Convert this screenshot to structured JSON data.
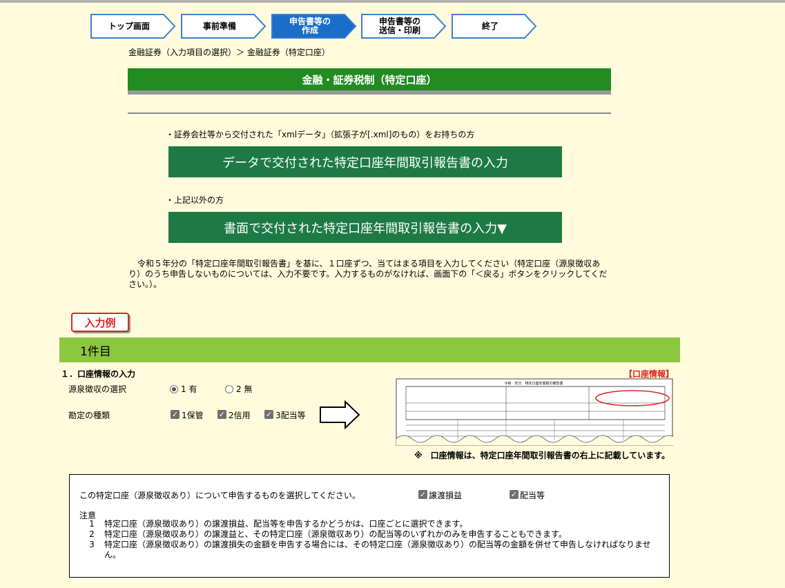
{
  "steps": [
    {
      "label": "トップ画面",
      "active": false
    },
    {
      "label": "事前準備",
      "active": false
    },
    {
      "label": "申告書等の\n作成",
      "active": true
    },
    {
      "label": "申告書等の\n送信・印刷",
      "active": false
    },
    {
      "label": "終了",
      "active": false
    }
  ],
  "breadcrumb": "金融証券（入力項目の選択）＞ 金融証券（特定口座）",
  "header_title": "金融・証券税制（特定口座）",
  "note_xml": "・証券会社等から交付された「xmlデータ」（拡張子が[.xml]のもの）をお持ちの方",
  "btn_xml": "データで交付された特定口座年間取引報告書の入力",
  "note_other": "・上記以外の方",
  "btn_paper": "書面で交付された特定口座年間取引報告書の入力▼",
  "instruction": "令和５年分の「特定口座年間取引報告書」を基に、１口座ずつ、当てはまる項目を入力してください（特定口座（源泉徴収あり）のうち申告しないものについては、入力不要です。入力するものがなければ、画面下の「＜戻る」ボタンをクリックしてください。）。",
  "example_badge": "入力例",
  "case_title": "1件目",
  "section1_title": "１．口座情報の入力",
  "kouza_tag": "【口座情報】",
  "withholding": {
    "label": "源泉徴収の選択",
    "options": [
      "1 有",
      "2 無"
    ],
    "selected": 0
  },
  "account_types": {
    "label": "勘定の種類",
    "options": [
      "1保管",
      "2信用",
      "3配当等"
    ]
  },
  "caption": "※　口座情報は、特定口座年間取引報告書の右上に記載しています。",
  "report_title": "令和　年分　特定口座年間取引報告書",
  "box": {
    "question": "この特定口座（源泉徴収あり）について申告するものを選択してください。",
    "options": [
      "譲渡損益",
      "配当等"
    ],
    "note_heading": "注意",
    "notes": [
      {
        "n": "1",
        "text": "特定口座（源泉徴収あり）の譲渡損益、配当等を申告するかどうかは、口座ごとに選択できます。"
      },
      {
        "n": "2",
        "text": "特定口座（源泉徴収あり）の譲渡益と、その特定口座（源泉徴収あり）の配当等のいずれかのみを申告することもできます。"
      },
      {
        "n": "3",
        "text": "特定口座（源泉徴収あり）の譲渡損失の金額を申告する場合には、その特定口座（源泉徴収あり）の配当等の金額を併せて申告しなければなりません。"
      }
    ]
  },
  "colors": {
    "bg": "#fffbdc",
    "green": "#228b22",
    "button": "#1e7a45",
    "lime": "#8dc63f",
    "active_step": "#1a6ec9",
    "red": "#dd2222"
  }
}
